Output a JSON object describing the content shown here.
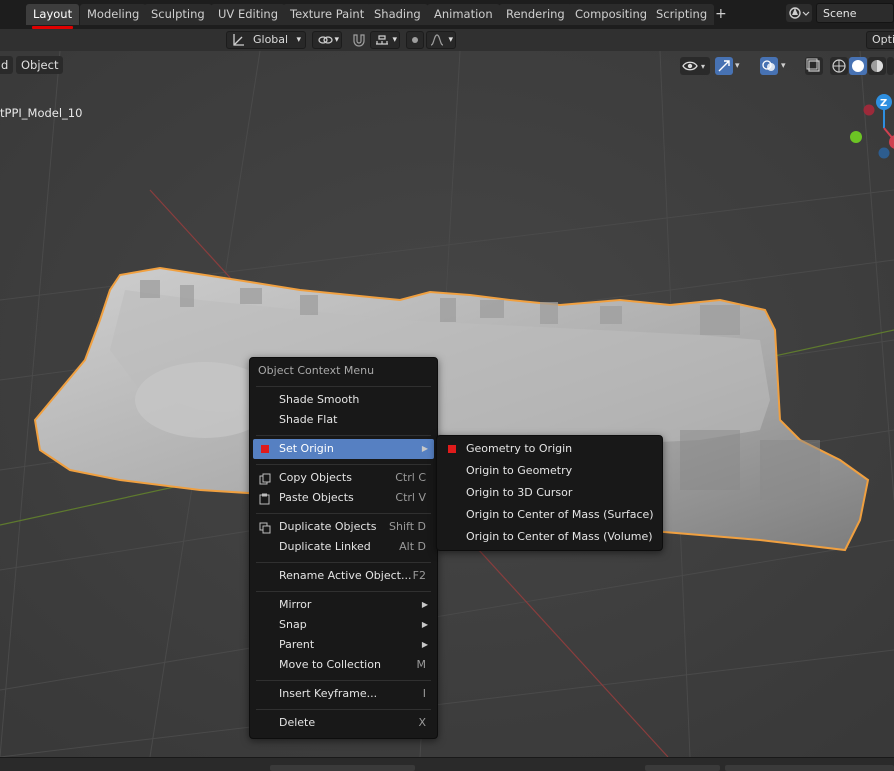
{
  "topbar": {
    "tabs": [
      {
        "label": "Layout",
        "active": true
      },
      {
        "label": "Modeling"
      },
      {
        "label": "Sculpting"
      },
      {
        "label": "UV Editing"
      },
      {
        "label": "Texture Paint"
      },
      {
        "label": "Shading"
      },
      {
        "label": "Animation"
      },
      {
        "label": "Rendering"
      },
      {
        "label": "Compositing"
      },
      {
        "label": "Scripting"
      }
    ],
    "add_tab": "+",
    "scene": "Scene"
  },
  "toolbar": {
    "transform_orientation": "Global",
    "options": "Opti"
  },
  "viewport": {
    "menu_partial": "d",
    "object_menu": "Object",
    "object_name": "tPPI_Model_10",
    "gizmo_axis_z": "Z"
  },
  "context_menu": {
    "title": "Object Context Menu",
    "items": [
      {
        "label": "Shade Smooth",
        "shortcut": ""
      },
      {
        "label": "Shade Flat",
        "shortcut": ""
      },
      {
        "label": "Set Origin",
        "shortcut": "",
        "submenu": true,
        "highlighted": true
      },
      {
        "label": "Copy Objects",
        "shortcut": "Ctrl C",
        "icon": "copy-icon"
      },
      {
        "label": "Paste Objects",
        "shortcut": "Ctrl V",
        "icon": "paste-icon"
      },
      {
        "label": "Duplicate Objects",
        "shortcut": "Shift D",
        "icon": "duplicate-icon"
      },
      {
        "label": "Duplicate Linked",
        "shortcut": "Alt D"
      },
      {
        "label": "Rename Active Object...",
        "shortcut": "F2"
      },
      {
        "label": "Mirror",
        "submenu": true
      },
      {
        "label": "Snap",
        "submenu": true
      },
      {
        "label": "Parent",
        "submenu": true
      },
      {
        "label": "Move to Collection",
        "shortcut": "M"
      },
      {
        "label": "Insert Keyframe...",
        "shortcut": "I"
      },
      {
        "label": "Delete",
        "shortcut": "X"
      }
    ]
  },
  "submenu": {
    "items": [
      {
        "label": "Geometry to Origin"
      },
      {
        "label": "Origin to Geometry"
      },
      {
        "label": "Origin to 3D Cursor"
      },
      {
        "label": "Origin to Center of Mass (Surface)"
      },
      {
        "label": "Origin to Center of Mass (Volume)"
      }
    ]
  },
  "colors": {
    "accent": "#4772b3",
    "highlight": "#5680c2",
    "outline": "#f0a040",
    "active_underline": "#e00000"
  }
}
